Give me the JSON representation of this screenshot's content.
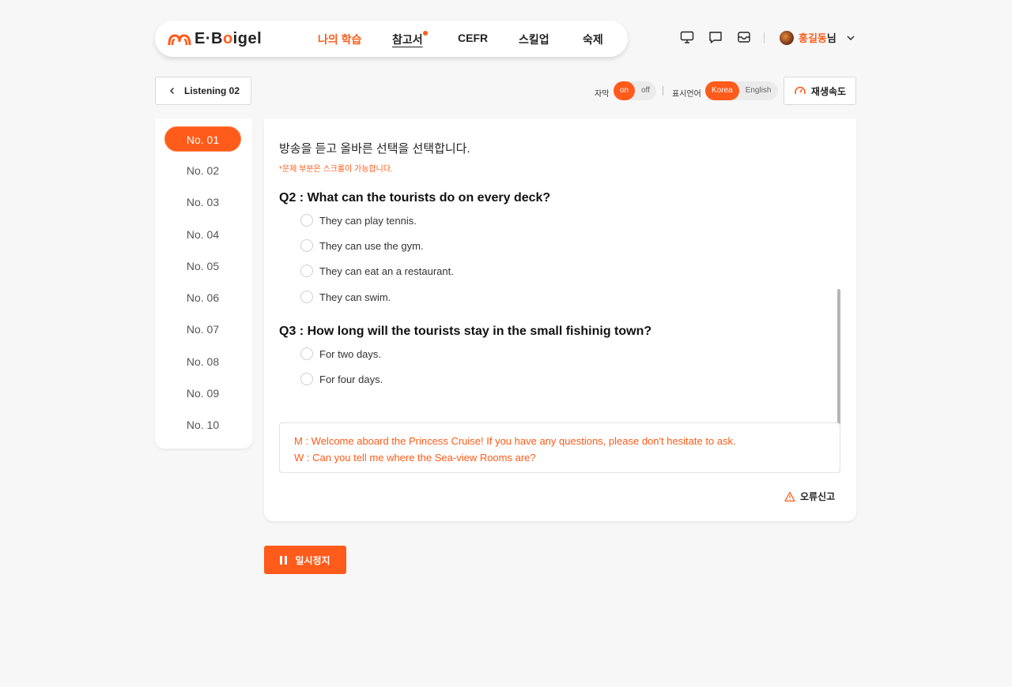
{
  "brand": {
    "logo_prefix": "E·B",
    "logo_o": "o",
    "logo_suffix": "igel",
    "accent": "#ff5b1a"
  },
  "nav": {
    "items": [
      {
        "label": "나의 학습"
      },
      {
        "label": "참고서"
      },
      {
        "label": "CEFR"
      },
      {
        "label": "스킬업"
      },
      {
        "label": "숙제"
      }
    ]
  },
  "header": {
    "icons": [
      "monitor-icon",
      "chat-icon",
      "inbox-icon"
    ],
    "user_name": "홍길동",
    "user_suffix": "님"
  },
  "toolbar": {
    "back_label": "Listening 02",
    "subtitle_label": "자막",
    "subtitle_on": "on",
    "subtitle_off": "off",
    "lang_label": "표시언어",
    "lang_korea": "Korea",
    "lang_english": "English",
    "speed_label": "재생속도"
  },
  "sidebar": {
    "items": [
      "No. 01",
      "No. 02",
      "No. 03",
      "No. 04",
      "No. 05",
      "No. 06",
      "No. 07",
      "No. 08",
      "No. 09",
      "No. 10"
    ],
    "active": "No. 01"
  },
  "main": {
    "instruction": "방송을 듣고 올바른 선택을 선택합니다.",
    "note": "*문제 부분은 스크롤이 가능합니다.",
    "questions": [
      {
        "title": "Q2 : What can the tourists do on every deck?",
        "options": [
          "They can play tennis.",
          "They can use the gym.",
          "They can eat an a restaurant.",
          "They can swim."
        ]
      },
      {
        "title": "Q3 : How long will the tourists stay in the small fishinig town?",
        "options": [
          "For two days.",
          "For four days."
        ]
      }
    ],
    "transcript": [
      "M : Welcome aboard the Princess Cruise! If you have any questions, please don't hesitate to ask.",
      "W : Can you tell me where the Sea-view Rooms are?"
    ],
    "report_label": "오류신고"
  },
  "player": {
    "pause_label": "일시정지"
  }
}
